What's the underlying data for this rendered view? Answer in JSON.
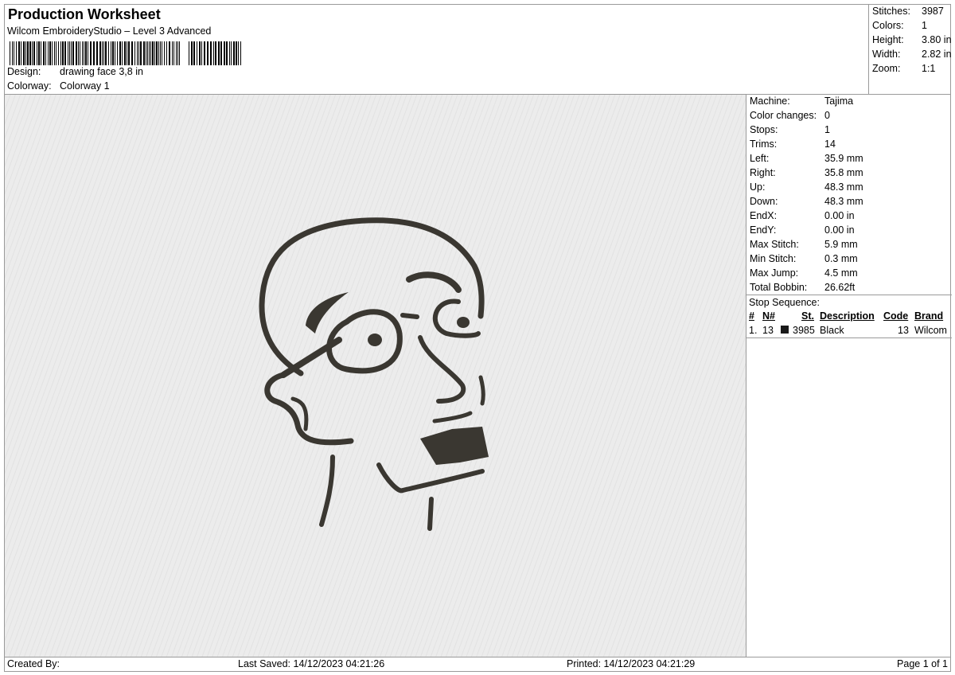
{
  "header": {
    "title": "Production Worksheet",
    "subtitle": "Wilcom EmbroideryStudio – Level 3 Advanced",
    "design_label": "Design:",
    "design_value": "drawing face 3,8 in",
    "colorway_label": "Colorway:",
    "colorway_value": "Colorway 1"
  },
  "summary": [
    {
      "label": "Stitches:",
      "value": "3987"
    },
    {
      "label": "Colors:",
      "value": "1"
    },
    {
      "label": "Height:",
      "value": "3.80 in"
    },
    {
      "label": "Width:",
      "value": "2.82 in"
    },
    {
      "label": "Zoom:",
      "value": "1:1"
    }
  ],
  "machine": [
    {
      "label": "Machine:",
      "value": "Tajima"
    },
    {
      "label": "Color changes:",
      "value": "0"
    },
    {
      "label": "Stops:",
      "value": "1"
    },
    {
      "label": "Trims:",
      "value": "14"
    },
    {
      "label": "Left:",
      "value": "35.9 mm"
    },
    {
      "label": "Right:",
      "value": "35.8 mm"
    },
    {
      "label": "Up:",
      "value": "48.3 mm"
    },
    {
      "label": "Down:",
      "value": "48.3 mm"
    },
    {
      "label": "EndX:",
      "value": "0.00 in"
    },
    {
      "label": "EndY:",
      "value": "0.00 in"
    },
    {
      "label": "Max Stitch:",
      "value": "5.9 mm"
    },
    {
      "label": "Min Stitch:",
      "value": "0.3 mm"
    },
    {
      "label": "Max Jump:",
      "value": "4.5 mm"
    },
    {
      "label": "Total Bobbin:",
      "value": "26.62ft"
    }
  ],
  "stop_sequence": {
    "title": "Stop Sequence:",
    "headers": {
      "num": "#",
      "n": "N#",
      "st": "St.",
      "description": "Description",
      "code": "Code",
      "brand": "Brand"
    },
    "rows": [
      {
        "num": "1.",
        "n": "13",
        "st": "3985",
        "description": "Black",
        "code": "13",
        "brand": "Wilcom",
        "color": "#1a1a1a"
      }
    ]
  },
  "footer": {
    "created_by": "Created By:",
    "last_saved": "Last Saved: 14/12/2023 04:21:26",
    "printed": "Printed: 14/12/2023 04:21:29",
    "page": "Page 1 of 1"
  },
  "colors": {
    "thread": "#3a3731",
    "fabric": "#ececec",
    "border": "#9a9a9a"
  }
}
